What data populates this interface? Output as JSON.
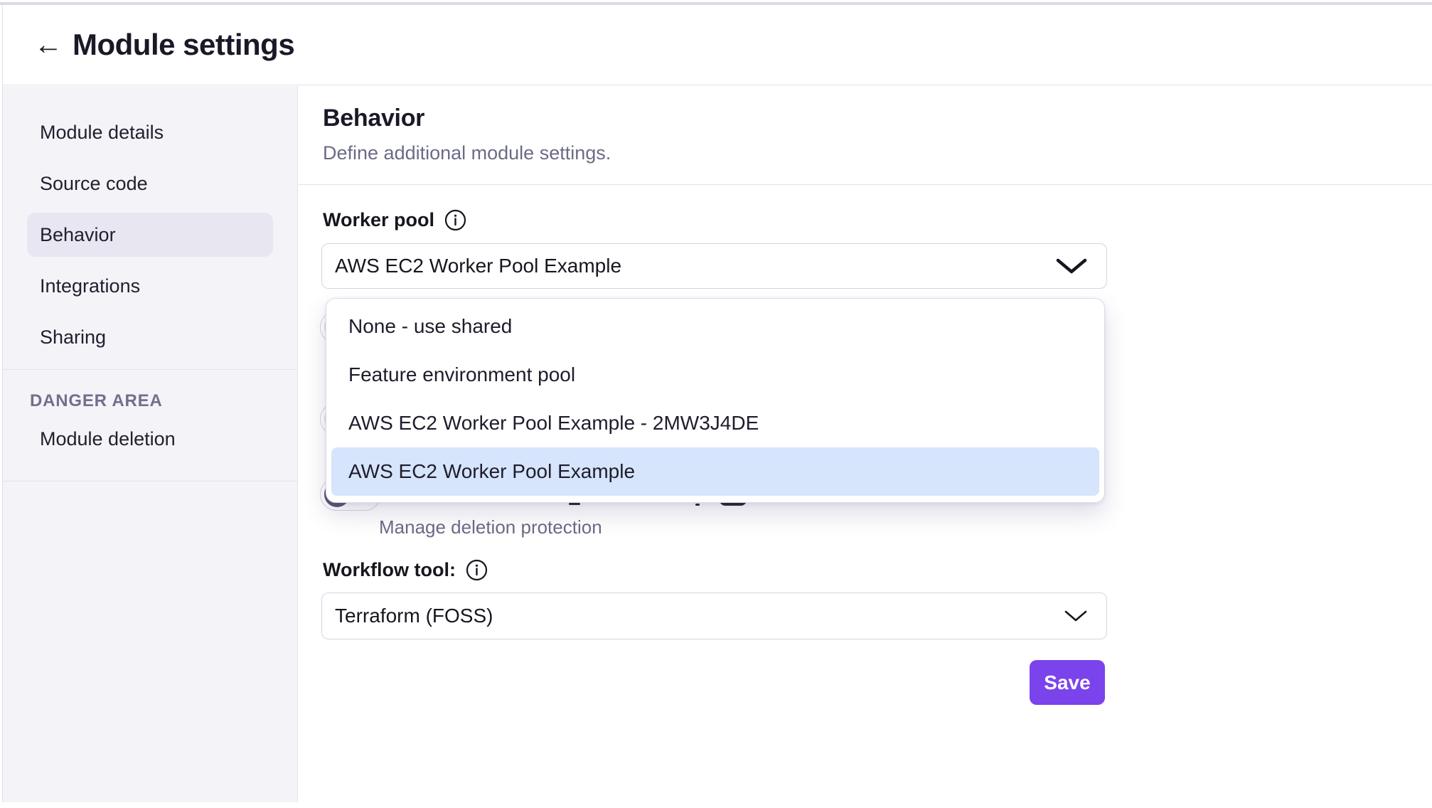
{
  "header": {
    "back_icon": "←",
    "title": "Module settings"
  },
  "sidebar": {
    "items": [
      {
        "label": "Module details",
        "active": false
      },
      {
        "label": "Source code",
        "active": false
      },
      {
        "label": "Behavior",
        "active": true
      },
      {
        "label": "Integrations",
        "active": false
      },
      {
        "label": "Sharing",
        "active": false
      }
    ],
    "danger": {
      "heading": "DANGER AREA",
      "items": [
        {
          "label": "Module deletion"
        }
      ]
    }
  },
  "main": {
    "section_title": "Behavior",
    "section_subtitle": "Define additional module settings.",
    "worker_pool": {
      "label": "Worker pool",
      "value": "AWS EC2 Worker Pool Example",
      "options": [
        "None - use shared",
        "Feature environment pool",
        "AWS EC2 Worker Pool Example - 2MW3J4DE",
        "AWS EC2 Worker Pool Example"
      ],
      "highlighted_option": "AWS EC2 Worker Pool Example"
    },
    "manage_link_label": "Manage deletion protection",
    "workflow_tool": {
      "label": "Workflow tool:",
      "value": "Terraform (FOSS)"
    },
    "save_label": "Save"
  },
  "colors": {
    "accent_purple": "#7a43ec",
    "dropdown_highlight": "#d6e4fc",
    "sidebar_bg": "#f4f3f8",
    "active_item_bg": "#e7e6f1",
    "divider": "#e3e1ee",
    "muted_text": "#6b6b86"
  }
}
